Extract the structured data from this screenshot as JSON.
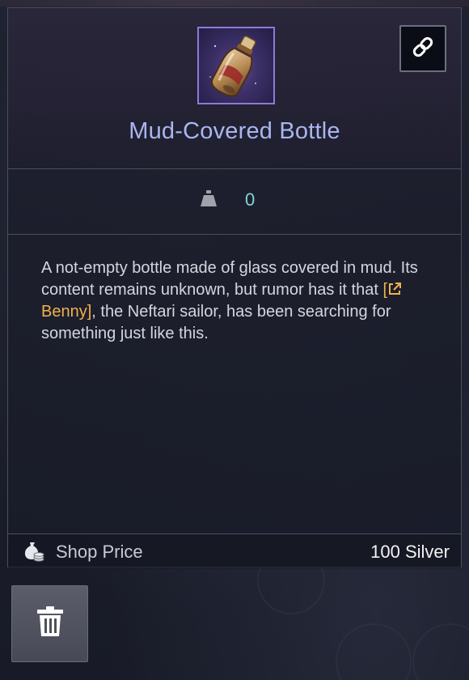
{
  "item": {
    "name": "Mud-Covered Bottle",
    "icon": "mud-covered-bottle-icon",
    "weight": "0",
    "description": {
      "before": "A not-empty bottle made of glass covered in mud. Its content remains unknown, but rumor has it that ",
      "link_open": "[",
      "link_name": "Benny",
      "link_close": "]",
      "after": ", the Neftari sailor, has been searching for something just like this."
    }
  },
  "price": {
    "label": "Shop Price",
    "value": "100 Silver"
  },
  "icons": {
    "link": "link-icon",
    "weight": "weight-icon",
    "coin": "coin-bag-icon",
    "trash": "trash-icon",
    "external": "external-link-icon"
  },
  "colors": {
    "item_name": "#a9b6f0",
    "weight_value": "#7fd6d6",
    "npc_link": "#f0b24a",
    "icon_border": "#8f7ad8"
  }
}
